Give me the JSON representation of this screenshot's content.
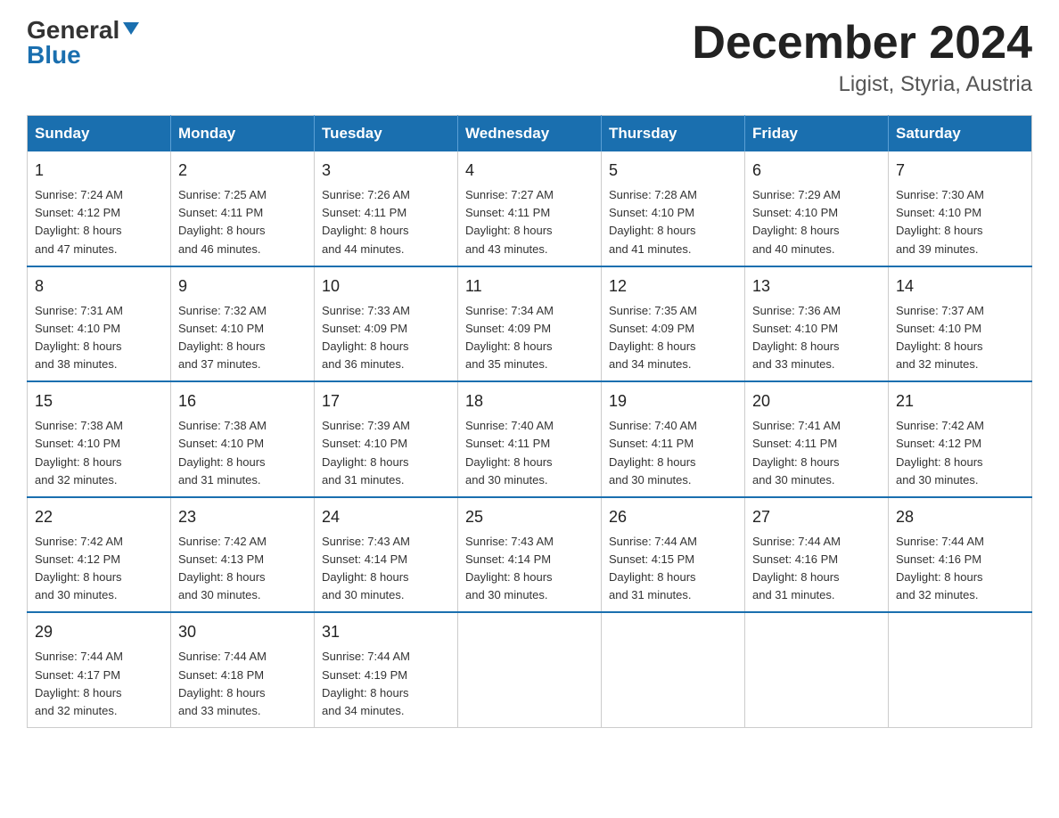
{
  "logo": {
    "general": "General",
    "blue": "Blue",
    "arrow": "▼"
  },
  "title": {
    "month": "December 2024",
    "location": "Ligist, Styria, Austria"
  },
  "headers": [
    "Sunday",
    "Monday",
    "Tuesday",
    "Wednesday",
    "Thursday",
    "Friday",
    "Saturday"
  ],
  "weeks": [
    [
      {
        "day": "1",
        "sunrise": "7:24 AM",
        "sunset": "4:12 PM",
        "daylight": "8 hours and 47 minutes."
      },
      {
        "day": "2",
        "sunrise": "7:25 AM",
        "sunset": "4:11 PM",
        "daylight": "8 hours and 46 minutes."
      },
      {
        "day": "3",
        "sunrise": "7:26 AM",
        "sunset": "4:11 PM",
        "daylight": "8 hours and 44 minutes."
      },
      {
        "day": "4",
        "sunrise": "7:27 AM",
        "sunset": "4:11 PM",
        "daylight": "8 hours and 43 minutes."
      },
      {
        "day": "5",
        "sunrise": "7:28 AM",
        "sunset": "4:10 PM",
        "daylight": "8 hours and 41 minutes."
      },
      {
        "day": "6",
        "sunrise": "7:29 AM",
        "sunset": "4:10 PM",
        "daylight": "8 hours and 40 minutes."
      },
      {
        "day": "7",
        "sunrise": "7:30 AM",
        "sunset": "4:10 PM",
        "daylight": "8 hours and 39 minutes."
      }
    ],
    [
      {
        "day": "8",
        "sunrise": "7:31 AM",
        "sunset": "4:10 PM",
        "daylight": "8 hours and 38 minutes."
      },
      {
        "day": "9",
        "sunrise": "7:32 AM",
        "sunset": "4:10 PM",
        "daylight": "8 hours and 37 minutes."
      },
      {
        "day": "10",
        "sunrise": "7:33 AM",
        "sunset": "4:09 PM",
        "daylight": "8 hours and 36 minutes."
      },
      {
        "day": "11",
        "sunrise": "7:34 AM",
        "sunset": "4:09 PM",
        "daylight": "8 hours and 35 minutes."
      },
      {
        "day": "12",
        "sunrise": "7:35 AM",
        "sunset": "4:09 PM",
        "daylight": "8 hours and 34 minutes."
      },
      {
        "day": "13",
        "sunrise": "7:36 AM",
        "sunset": "4:10 PM",
        "daylight": "8 hours and 33 minutes."
      },
      {
        "day": "14",
        "sunrise": "7:37 AM",
        "sunset": "4:10 PM",
        "daylight": "8 hours and 32 minutes."
      }
    ],
    [
      {
        "day": "15",
        "sunrise": "7:38 AM",
        "sunset": "4:10 PM",
        "daylight": "8 hours and 32 minutes."
      },
      {
        "day": "16",
        "sunrise": "7:38 AM",
        "sunset": "4:10 PM",
        "daylight": "8 hours and 31 minutes."
      },
      {
        "day": "17",
        "sunrise": "7:39 AM",
        "sunset": "4:10 PM",
        "daylight": "8 hours and 31 minutes."
      },
      {
        "day": "18",
        "sunrise": "7:40 AM",
        "sunset": "4:11 PM",
        "daylight": "8 hours and 30 minutes."
      },
      {
        "day": "19",
        "sunrise": "7:40 AM",
        "sunset": "4:11 PM",
        "daylight": "8 hours and 30 minutes."
      },
      {
        "day": "20",
        "sunrise": "7:41 AM",
        "sunset": "4:11 PM",
        "daylight": "8 hours and 30 minutes."
      },
      {
        "day": "21",
        "sunrise": "7:42 AM",
        "sunset": "4:12 PM",
        "daylight": "8 hours and 30 minutes."
      }
    ],
    [
      {
        "day": "22",
        "sunrise": "7:42 AM",
        "sunset": "4:12 PM",
        "daylight": "8 hours and 30 minutes."
      },
      {
        "day": "23",
        "sunrise": "7:42 AM",
        "sunset": "4:13 PM",
        "daylight": "8 hours and 30 minutes."
      },
      {
        "day": "24",
        "sunrise": "7:43 AM",
        "sunset": "4:14 PM",
        "daylight": "8 hours and 30 minutes."
      },
      {
        "day": "25",
        "sunrise": "7:43 AM",
        "sunset": "4:14 PM",
        "daylight": "8 hours and 30 minutes."
      },
      {
        "day": "26",
        "sunrise": "7:44 AM",
        "sunset": "4:15 PM",
        "daylight": "8 hours and 31 minutes."
      },
      {
        "day": "27",
        "sunrise": "7:44 AM",
        "sunset": "4:16 PM",
        "daylight": "8 hours and 31 minutes."
      },
      {
        "day": "28",
        "sunrise": "7:44 AM",
        "sunset": "4:16 PM",
        "daylight": "8 hours and 32 minutes."
      }
    ],
    [
      {
        "day": "29",
        "sunrise": "7:44 AM",
        "sunset": "4:17 PM",
        "daylight": "8 hours and 32 minutes."
      },
      {
        "day": "30",
        "sunrise": "7:44 AM",
        "sunset": "4:18 PM",
        "daylight": "8 hours and 33 minutes."
      },
      {
        "day": "31",
        "sunrise": "7:44 AM",
        "sunset": "4:19 PM",
        "daylight": "8 hours and 34 minutes."
      },
      null,
      null,
      null,
      null
    ]
  ],
  "labels": {
    "sunrise": "Sunrise:",
    "sunset": "Sunset:",
    "daylight": "Daylight:"
  }
}
